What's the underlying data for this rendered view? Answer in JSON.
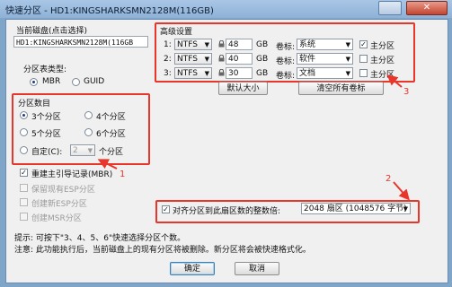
{
  "window": {
    "title": "快速分区 - HD1:KINGSHARKSMN2128M(116GB)"
  },
  "disk": {
    "label": "当前磁盘(点击选择)",
    "value": "HD1:KINGSHARKSMN2128M(116GB"
  },
  "table_type": {
    "label": "分区表类型:",
    "options": [
      "MBR",
      "GUID"
    ],
    "selected": "MBR"
  },
  "count": {
    "label": "分区数目",
    "options": [
      "3个分区",
      "4个分区",
      "5个分区",
      "6个分区"
    ],
    "selected": "3个分区",
    "custom_label": "自定(C):",
    "custom_value": "2",
    "custom_suffix": "个分区"
  },
  "options": {
    "rebuild_mbr": "重建主引导记录(MBR)",
    "keep_esp": "保留现有ESP分区",
    "create_esp": "创建新ESP分区",
    "create_msr": "创建MSR分区"
  },
  "advanced": {
    "title": "高级设置",
    "size_unit": "GB",
    "label_prefix": "卷标:",
    "primary_label": "主分区",
    "rows": [
      {
        "num": "1:",
        "fs": "NTFS",
        "size": "48",
        "label": "系统",
        "primary": true
      },
      {
        "num": "2:",
        "fs": "NTFS",
        "size": "40",
        "label": "软件",
        "primary": false
      },
      {
        "num": "3:",
        "fs": "NTFS",
        "size": "30",
        "label": "文档",
        "primary": false
      }
    ],
    "default_size_btn": "默认大小",
    "clear_labels_btn": "清空所有卷标"
  },
  "align": {
    "label": "对齐分区到此扇区数的整数倍:",
    "value": "2048 扇区 (1048576 字节)"
  },
  "annotations": [
    "1",
    "2",
    "3"
  ],
  "hints": {
    "tip": "提示: 可按下\"3、4、5、6\"快速选择分区个数。",
    "note": "注意: 此功能执行后，当前磁盘上的现有分区将被删除。新分区将会被快速格式化。"
  },
  "buttons": {
    "ok": "确定",
    "cancel": "取消"
  },
  "colors": {
    "annotation": "#e8362a",
    "accent": "#1a3c8c"
  }
}
